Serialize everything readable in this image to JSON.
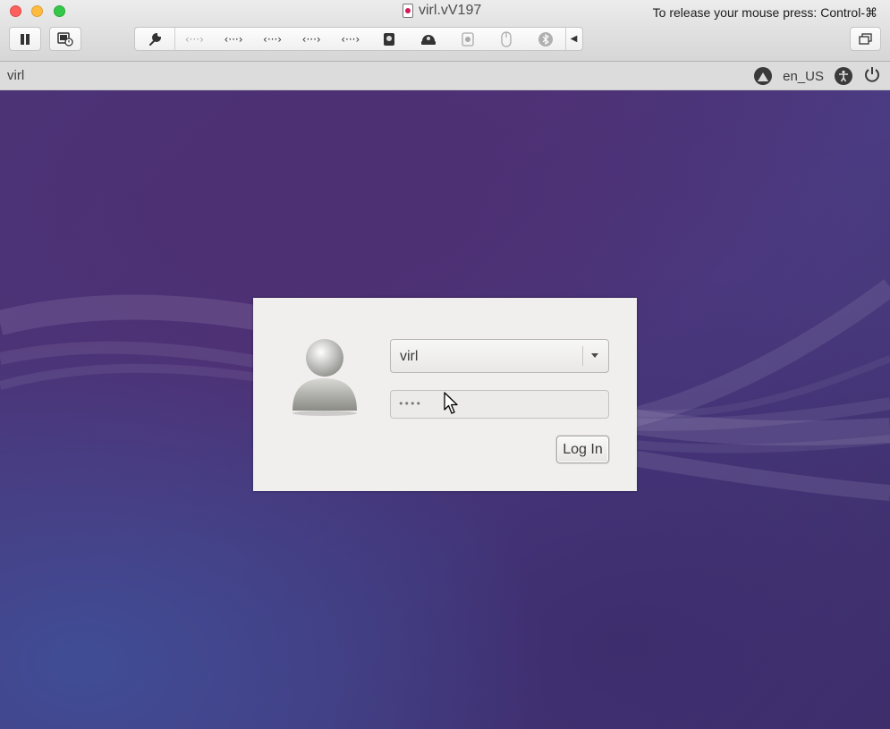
{
  "window": {
    "title": "virl.vV197",
    "release_hint": "To release your mouse press: Control-⌘"
  },
  "toolbar": {
    "items": [
      {
        "icon": "wrench-icon",
        "glyph": "🔧",
        "dim": false
      },
      {
        "icon": "network-adapter-icon",
        "glyph": "‹···›",
        "dim": true
      },
      {
        "icon": "network-adapter-icon",
        "glyph": "‹···›",
        "dim": false
      },
      {
        "icon": "network-adapter-icon",
        "glyph": "‹···›",
        "dim": false
      },
      {
        "icon": "network-adapter-icon",
        "glyph": "‹···›",
        "dim": false
      },
      {
        "icon": "network-adapter-icon",
        "glyph": "‹···›",
        "dim": false
      },
      {
        "icon": "hard-disk-icon",
        "glyph": "▣",
        "dim": false
      },
      {
        "icon": "optical-drive-icon",
        "glyph": "◒",
        "dim": false
      },
      {
        "icon": "camera-icon",
        "glyph": "◙",
        "dim": true
      },
      {
        "icon": "mouse-icon",
        "glyph": "⌂",
        "dim": true
      },
      {
        "icon": "bluetooth-icon",
        "glyph": "ᛒ",
        "dim": true
      }
    ]
  },
  "panel": {
    "hostname": "virl",
    "language": "en_US"
  },
  "login": {
    "username": "virl",
    "password_mask": "••••",
    "login_button": "Log In"
  }
}
